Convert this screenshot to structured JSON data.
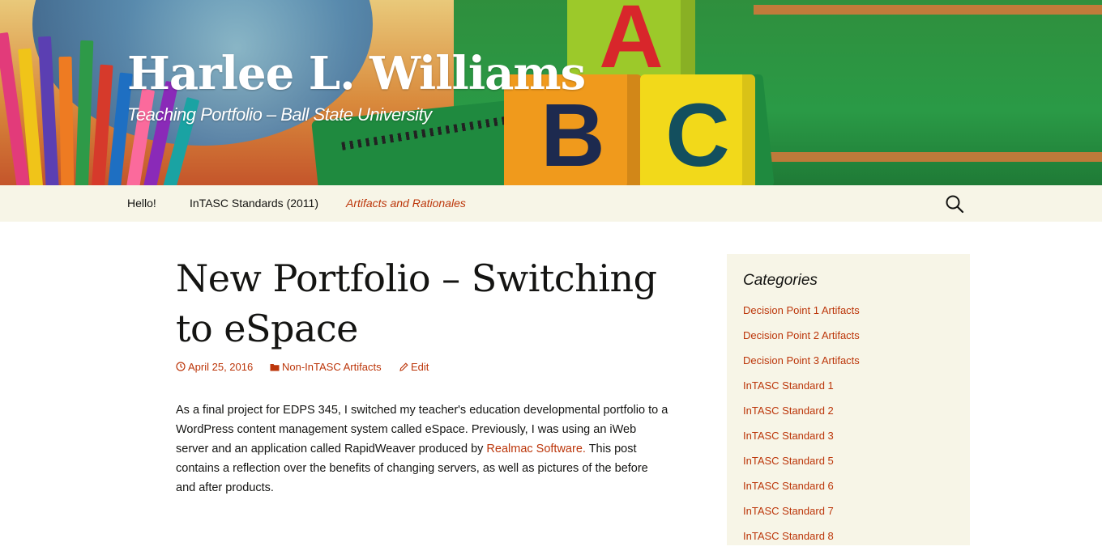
{
  "site": {
    "title": "Harlee L. Williams",
    "description": "Teaching Portfolio – Ball State University"
  },
  "header_blocks": [
    "A",
    "B",
    "C"
  ],
  "nav": {
    "items": [
      {
        "label": "Hello!",
        "active": false
      },
      {
        "label": "InTASC Standards (2011)",
        "active": false
      },
      {
        "label": "Artifacts and Rationales",
        "active": true
      }
    ],
    "search_icon": "search-icon"
  },
  "post": {
    "title": "New Portfolio – Switching to eSpace",
    "date": "April 25, 2016",
    "category": "Non-InTASC Artifacts",
    "edit_label": "Edit",
    "body_before_link": "As a final project for EDPS 345, I switched my teacher's education developmental portfolio to a WordPress content management system called eSpace. Previously, I was using an iWeb server and an application called RapidWeaver produced by ",
    "link_text": "Realmac Software.",
    "body_after_link": " This post contains a reflection over the benefits of changing servers, as well as pictures of the before and after products."
  },
  "sidebar": {
    "widget_title": "Categories",
    "categories": [
      "Decision Point 1 Artifacts",
      "Decision Point 2 Artifacts",
      "Decision Point 3 Artifacts",
      "InTASC Standard 1",
      "InTASC Standard 2",
      "InTASC Standard 3",
      "InTASC Standard 5",
      "InTASC Standard 6",
      "InTASC Standard 7",
      "InTASC Standard 8"
    ]
  },
  "colors": {
    "accent": "#bc360a",
    "nav_background": "#f7f5e7",
    "text": "#141412"
  }
}
